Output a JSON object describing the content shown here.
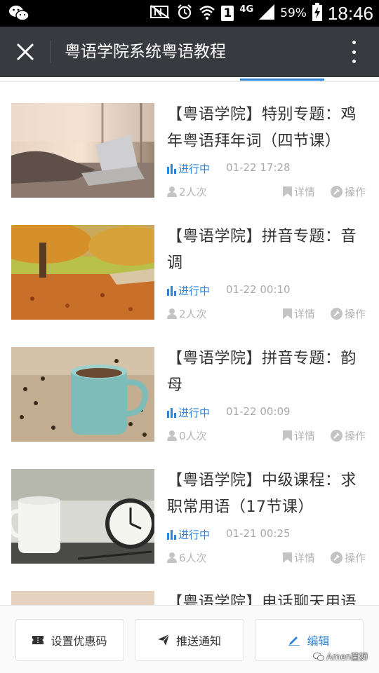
{
  "status_bar": {
    "network": "4G",
    "sim": "1",
    "battery": "59%",
    "time": "18:46"
  },
  "header": {
    "title": "粤语学院系统粤语教程"
  },
  "courses": [
    {
      "title": "【粤语学院】特别专题：鸡年粤语拜年词（四节课）",
      "status": "进行中",
      "datetime": "01-22 17:28",
      "views": "2人次",
      "detail_label": "详情",
      "action_label": "操作"
    },
    {
      "title": "【粤语学院】拼音专题：音调",
      "status": "进行中",
      "datetime": "01-22 00:10",
      "views": "2人次",
      "detail_label": "详情",
      "action_label": "操作"
    },
    {
      "title": "【粤语学院】拼音专题：韵母",
      "status": "进行中",
      "datetime": "01-22 00:09",
      "views": "0人次",
      "detail_label": "详情",
      "action_label": "操作"
    },
    {
      "title": "【粤语学院】中级课程：求职常用语（17节课）",
      "status": "进行中",
      "datetime": "01-21 00:25",
      "views": "6人次",
      "detail_label": "详情",
      "action_label": "操作"
    },
    {
      "title": "【粤语学院】电话聊天用语",
      "status": "",
      "datetime": "",
      "views": "",
      "detail_label": "",
      "action_label": ""
    }
  ],
  "bottom_bar": {
    "coupon_label": "设置优惠码",
    "push_label": "推送通知",
    "edit_label": "编辑"
  },
  "watermark": "Amen菌狮",
  "colors": {
    "accent": "#2e84d8",
    "header_bg": "#393a3f",
    "muted": "#b4b4b4"
  }
}
